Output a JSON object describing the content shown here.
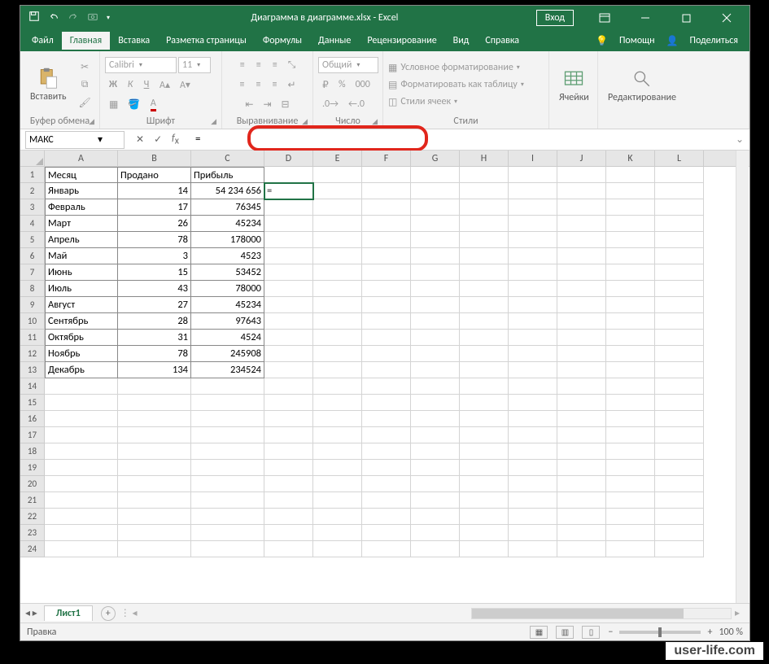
{
  "title": "Диаграмма в диаграмме.xlsx - Excel",
  "signin": "Вход",
  "tabs": {
    "file": "Файл",
    "home": "Главная",
    "insert": "Вставка",
    "layout": "Разметка страницы",
    "formulas": "Формулы",
    "data": "Данные",
    "review": "Рецензирование",
    "view": "Вид",
    "help": "Справка",
    "tell": "Помощн",
    "share": "Поделиться"
  },
  "groups": {
    "clipboard": "Буфер обмена",
    "font": "Шрифт",
    "align": "Выравнивание",
    "number": "Число",
    "styles": "Стили",
    "cells": "Ячейки",
    "editing": "Редактирование"
  },
  "font": {
    "name": "Calibri",
    "size": "11"
  },
  "number_format": "Общий",
  "styles": {
    "cond": "Условное форматирование",
    "table": "Форматировать как таблицу",
    "cell": "Стили ячеек"
  },
  "namebox": "МАКС",
  "formula": "=",
  "columns": [
    "A",
    "B",
    "C",
    "D",
    "E",
    "F",
    "G",
    "H",
    "I",
    "J",
    "K",
    "L"
  ],
  "headers": {
    "a": "Месяц",
    "b": "Продано",
    "c": "Прибыль"
  },
  "data": [
    {
      "m": "Январь",
      "s": "14",
      "p": "54 234 656"
    },
    {
      "m": "Февраль",
      "s": "17",
      "p": "76345"
    },
    {
      "m": "Март",
      "s": "26",
      "p": "45234"
    },
    {
      "m": "Апрель",
      "s": "78",
      "p": "178000"
    },
    {
      "m": "Май",
      "s": "3",
      "p": "4523"
    },
    {
      "m": "Июнь",
      "s": "15",
      "p": "53452"
    },
    {
      "m": "Июль",
      "s": "43",
      "p": "78000"
    },
    {
      "m": "Август",
      "s": "27",
      "p": "45234"
    },
    {
      "m": "Сентябрь",
      "s": "28",
      "p": "97643"
    },
    {
      "m": "Октябрь",
      "s": "31",
      "p": "4524"
    },
    {
      "m": "Ноябрь",
      "s": "78",
      "p": "245908"
    },
    {
      "m": "Декабрь",
      "s": "134",
      "p": "234524"
    }
  ],
  "active_cell_display": "=",
  "sheet": "Лист1",
  "status": "Правка",
  "zoom": "100 %",
  "watermark": "user-life.com"
}
